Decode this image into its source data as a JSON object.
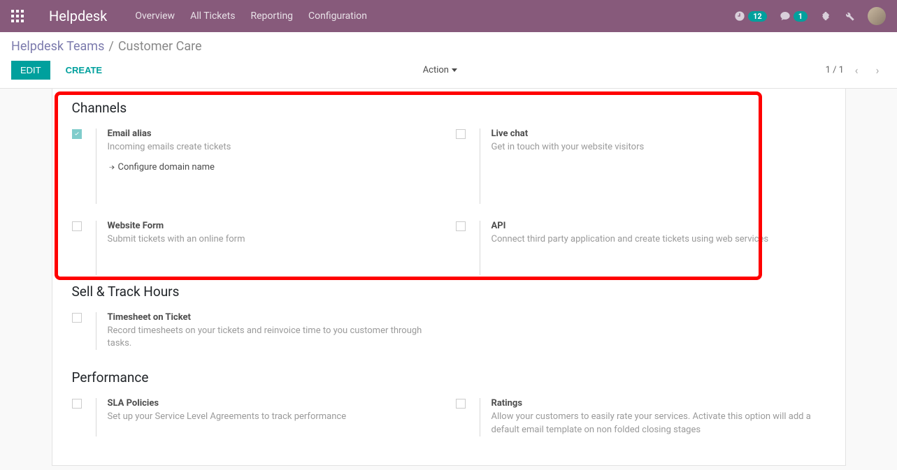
{
  "navbar": {
    "brand": "Helpdesk",
    "menu": [
      "Overview",
      "All Tickets",
      "Reporting",
      "Configuration"
    ],
    "clock_badge": "12",
    "chat_badge": "1"
  },
  "breadcrumb": {
    "parent": "Helpdesk Teams",
    "sep": "/",
    "current": "Customer Care"
  },
  "buttons": {
    "edit": "EDIT",
    "create": "CREATE",
    "action": "Action"
  },
  "pager": {
    "text": "1 / 1"
  },
  "sections": {
    "channels": {
      "title": "Channels",
      "items": [
        {
          "title": "Email alias",
          "desc": "Incoming emails create tickets",
          "checked": true,
          "link": "Configure domain name"
        },
        {
          "title": "Live chat",
          "desc": "Get in touch with your website visitors",
          "checked": false
        },
        {
          "title": "Website Form",
          "desc": "Submit tickets with an online form",
          "checked": false
        },
        {
          "title": "API",
          "desc": "Connect third party application and create tickets using web services",
          "checked": false
        }
      ]
    },
    "sell_track": {
      "title": "Sell & Track Hours",
      "items": [
        {
          "title": "Timesheet on Ticket",
          "desc": "Record timesheets on your tickets and reinvoice time to you customer through tasks.",
          "checked": false
        }
      ]
    },
    "performance": {
      "title": "Performance",
      "items": [
        {
          "title": "SLA Policies",
          "desc": "Set up your Service Level Agreements to track performance",
          "checked": false
        },
        {
          "title": "Ratings",
          "desc": "Allow your customers to easily rate your services. Activate this option will add a default email template on non folded closing stages",
          "checked": false
        }
      ]
    }
  }
}
